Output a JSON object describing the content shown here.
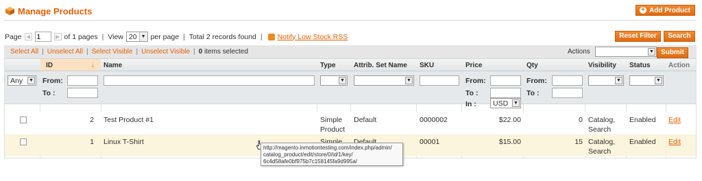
{
  "header": {
    "title": "Manage Products",
    "add_button": "Add Product",
    "title_icon": "box-icon"
  },
  "pager": {
    "page_label": "Page",
    "page_value": "1",
    "of_pages": "of 1 pages",
    "view_label": "View",
    "view_value": "20",
    "per_page": "per page",
    "total": "Total 2 records found",
    "rss_link": "Notify Low Stock RSS"
  },
  "buttons": {
    "reset_filter": "Reset Filter",
    "search": "Search",
    "submit": "Submit"
  },
  "massaction": {
    "select_all": "Select All",
    "unselect_all": "Unselect All",
    "select_visible": "Select Visible",
    "unselect_visible": "Unselect Visible",
    "count": "0",
    "items_selected": "items selected",
    "actions_label": "Actions"
  },
  "columns": [
    "ID",
    "Name",
    "Type",
    "Attrib. Set Name",
    "SKU",
    "Price",
    "Qty",
    "Visibility",
    "Status",
    "Action"
  ],
  "sort_indicator": "↓",
  "filters": {
    "any": "Any",
    "from": "From:",
    "to": "To :",
    "in": "In :",
    "currency": "USD"
  },
  "rows": [
    {
      "id": "2",
      "name": "Test Product #1",
      "type_line1": "Simple",
      "type_line2": "Product",
      "attrib_set": "Default",
      "sku": "0000002",
      "price": "$22.00",
      "qty": "0",
      "vis_line1": "Catalog,",
      "vis_line2": "Search",
      "status": "Enabled",
      "action": "Edit"
    },
    {
      "id": "1",
      "name": "Linux T-Shirt",
      "type_line1": "Simple",
      "type_line2": "",
      "attrib_set": "Default",
      "sku": "00001",
      "price": "$15.00",
      "qty": "15",
      "vis_line1": "Catalog,",
      "vis_line2": "Search",
      "status": "Enabled",
      "action": "Edit"
    }
  ],
  "tooltip": {
    "line1": "http://magento.inmotiontesting.com/index.php/admin/",
    "line2": "catalog_product/edit/store/0/id/1/key/",
    "line3": "6c4d58afe0bf975b7c158145fa9d995a/"
  },
  "colors": {
    "accent": "#eb5e00",
    "button": "#e06a11",
    "highlight_row": "#fcf5dd"
  }
}
